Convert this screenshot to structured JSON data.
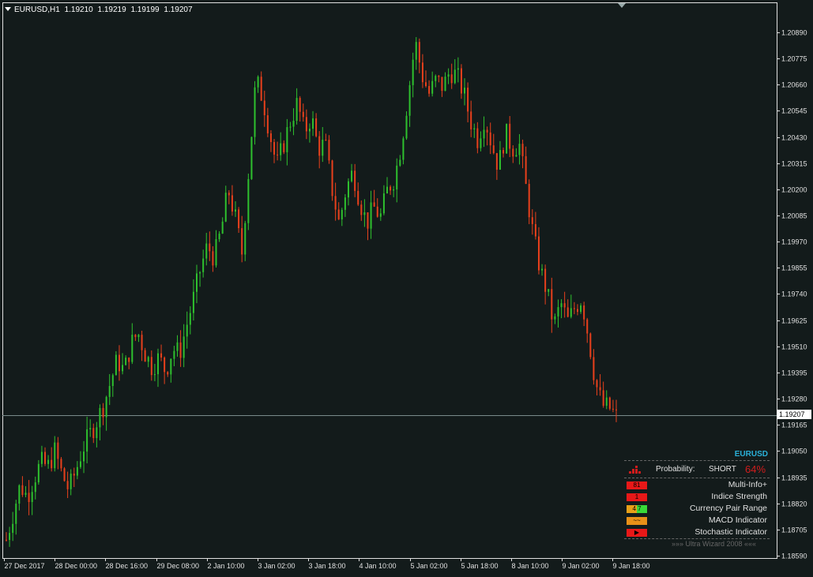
{
  "header": {
    "symbol": "EURUSD,H1",
    "open": "1.19210",
    "high": "1.19219",
    "low": "1.19199",
    "close": "1.19207"
  },
  "current_price_label": "1.19207",
  "colors": {
    "background": "#131b1b",
    "bull": "#2ec12e",
    "bear": "#e8401c",
    "axis": "#e0e0e0",
    "price_line": "#7a8a8a"
  },
  "chart_data": {
    "type": "candlestick",
    "symbol": "EURUSD",
    "timeframe": "H1",
    "ylim": [
      1.1859,
      1.209
    ],
    "y_ticks": [
      "1.20890",
      "1.20775",
      "1.20660",
      "1.20545",
      "1.20430",
      "1.20315",
      "1.20200",
      "1.20085",
      "1.19970",
      "1.19855",
      "1.19740",
      "1.19625",
      "1.19510",
      "1.19395",
      "1.19280",
      "1.19165",
      "1.19050",
      "1.18935",
      "1.18820",
      "1.18705",
      "1.18590"
    ],
    "x_ticks": [
      "27 Dec 2017",
      "28 Dec 00:00",
      "28 Dec 16:00",
      "29 Dec 08:00",
      "2 Jan 10:00",
      "3 Jan 02:00",
      "3 Jan 18:00",
      "4 Jan 10:00",
      "5 Jan 02:00",
      "5 Jan 18:00",
      "8 Jan 10:00",
      "9 Jan 02:00",
      "9 Jan 18:00"
    ],
    "last_close": 1.19207,
    "grid": false,
    "close_path": [
      1.1866,
      1.1878,
      1.189,
      1.1885,
      1.1893,
      1.19,
      1.1898,
      1.1905,
      1.1895,
      1.1888,
      1.1896,
      1.1906,
      1.1912,
      1.1918,
      1.1925,
      1.1935,
      1.1945,
      1.194,
      1.1952,
      1.1957,
      1.1948,
      1.1942,
      1.1946,
      1.194,
      1.195,
      1.1948,
      1.196,
      1.1972,
      1.1985,
      1.1995,
      1.199,
      1.2002,
      1.202,
      1.2008,
      1.1992,
      1.203,
      1.2068,
      1.206,
      1.2045,
      1.203,
      1.204,
      1.205,
      1.2058,
      1.2045,
      1.2052,
      1.2038,
      1.204,
      1.202,
      1.2005,
      1.202,
      1.2028,
      1.2015,
      1.2005,
      1.2012,
      1.2008,
      1.202,
      1.2025,
      1.204,
      1.2062,
      1.2085,
      1.207,
      1.2062,
      1.2068,
      1.2065,
      1.2072,
      1.207,
      1.2062,
      1.205,
      1.2042,
      1.2052,
      1.204,
      1.203,
      1.2045,
      1.2038,
      1.204,
      1.202,
      1.2,
      1.1985,
      1.1975,
      1.196,
      1.197,
      1.1962,
      1.1968,
      1.1972,
      1.1955,
      1.1935,
      1.1925,
      1.1924,
      1.192
    ]
  },
  "wizard": {
    "symbol": "EURUSD",
    "probability_label": "Probability:",
    "direction": "SHORT",
    "percent": "64%",
    "rows": [
      {
        "badge": "81",
        "badge_color": "#e81818",
        "label": "Multi-Info+"
      },
      {
        "badge": "1",
        "badge_color": "#e81818",
        "label": "Indice Strength"
      },
      {
        "badge": "4 7",
        "badge_color": "#e8a018",
        "label": "Currency Pair Range"
      },
      {
        "badge": "~~",
        "badge_color": "#e89018",
        "label": "MACD Indicator"
      },
      {
        "badge": "▶",
        "badge_color": "#e81818",
        "label": "Stochastic Indicator"
      }
    ],
    "brand": "»»» Ultra Wizard 2008 «««"
  }
}
